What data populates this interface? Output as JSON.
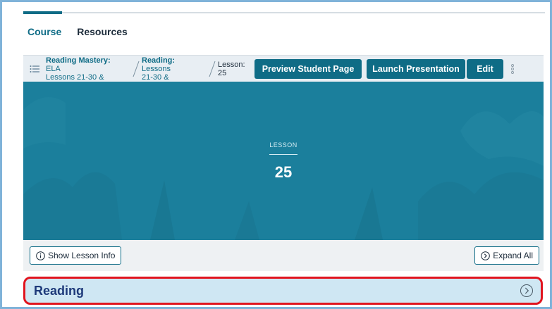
{
  "tabs": [
    {
      "label": "Course",
      "active": true
    },
    {
      "label": "Resources",
      "active": false
    }
  ],
  "breadcrumb": [
    {
      "bold": "Reading Mastery:",
      "rest": " ELA",
      "line2": "Lessons 21-30 &"
    },
    {
      "bold": "Reading:",
      "rest": " Lessons",
      "line2": "21-30 &"
    },
    {
      "bold": "",
      "rest": "Lesson:",
      "line2": "25"
    }
  ],
  "toolbar": {
    "preview_label": "Preview Student Page",
    "launch_label": "Launch Presentation",
    "edit_label": "Edit"
  },
  "hero": {
    "eyebrow": "LESSON",
    "number": "25"
  },
  "actions": {
    "show_info_label": "Show Lesson Info",
    "expand_all_label": "Expand All"
  },
  "section": {
    "title": "Reading"
  },
  "colors": {
    "accent": "#0f6c86",
    "hero_bg": "#1b7f9c",
    "section_bg": "#cfe7f3",
    "highlight": "#e1151f",
    "section_title": "#1e3a7a"
  },
  "icons": {
    "list": "list-icon",
    "more": "vertical-dots-icon",
    "info": "info-circle-icon",
    "chevron": "chevron-right-circle-icon"
  }
}
